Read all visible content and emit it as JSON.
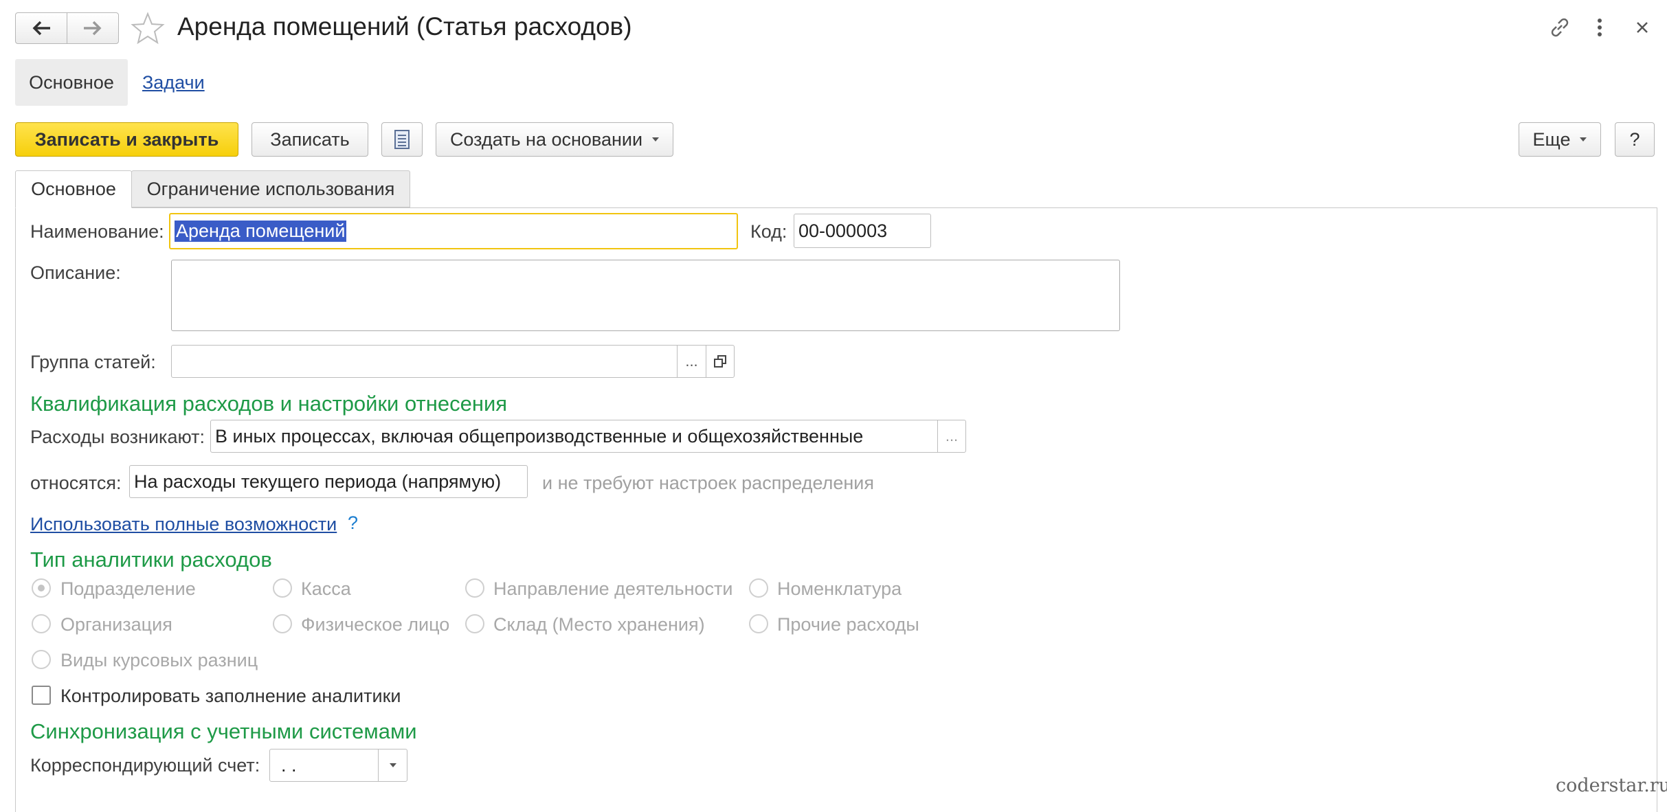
{
  "window": {
    "title": "Аренда помещений (Статья расходов)",
    "icons": [
      "arrow-left-icon",
      "arrow-right-icon",
      "star-icon",
      "link-icon",
      "more-vertical-icon",
      "close-icon"
    ]
  },
  "nav": {
    "tab_main": "Основное",
    "tab_tasks": "Задачи"
  },
  "toolbar": {
    "save_close": "Записать и закрыть",
    "save": "Записать",
    "create_based": "Создать на основании",
    "more": "Еще",
    "help": "?"
  },
  "form_tabs": {
    "main": "Основное",
    "restriction": "Ограничение использования"
  },
  "form": {
    "name_label": "Наименование:",
    "name_value": "Аренда помещений",
    "code_label": "Код:",
    "code_value": "00-000003",
    "description_label": "Описание:",
    "description_value": "",
    "group_label": "Группа статей:",
    "group_value": "",
    "ellipsis": "...",
    "section_qualification": "Квалификация расходов и настройки отнесения",
    "arise_label": "Расходы возникают:",
    "arise_value": "В иных процессах, включая общепроизводственные и общехозяйственные",
    "relate_label": "относятся:",
    "relate_value": "На расходы текущего периода (напрямую)",
    "relate_note": "и не требуют настроек распределения",
    "full_link": "Использовать полные возможности",
    "full_help": "?",
    "section_analytics": "Тип аналитики расходов",
    "radio_options": [
      {
        "label": "Подразделение",
        "checked": true
      },
      {
        "label": "Касса",
        "checked": false
      },
      {
        "label": "Направление деятельности",
        "checked": false
      },
      {
        "label": "Номенклатура",
        "checked": false
      },
      {
        "label": "Организация",
        "checked": false
      },
      {
        "label": "Физическое лицо",
        "checked": false
      },
      {
        "label": "Склад (Место хранения)",
        "checked": false
      },
      {
        "label": "Прочие расходы",
        "checked": false
      },
      {
        "label": "Виды курсовых разниц",
        "checked": false
      }
    ],
    "control_checkbox": "Контролировать заполнение аналитики",
    "control_checked": false,
    "section_sync": "Синхронизация с учетными системами",
    "account_label": "Корреспондирующий счет:",
    "account_value": " .  ."
  },
  "watermark": "coderstar.ru",
  "colors": {
    "accent_yellow": "#f6cf0b",
    "section_green": "#1e9a47",
    "link_blue": "#1f4ea3",
    "selection_blue": "#3a5cc7"
  }
}
